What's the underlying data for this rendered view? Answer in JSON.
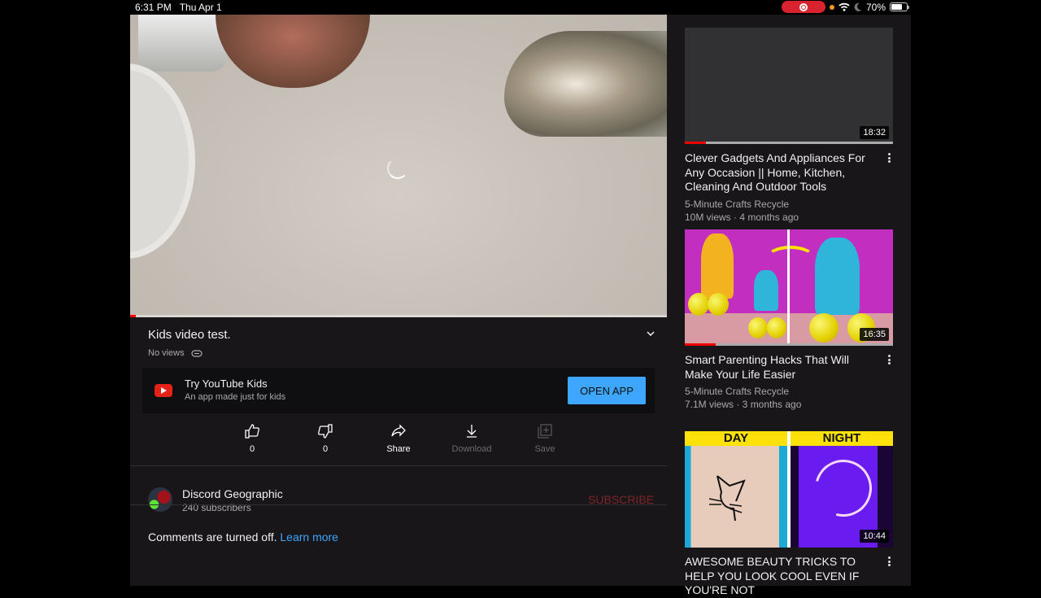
{
  "status_bar": {
    "time": "6:31 PM",
    "date": "Thu Apr 1",
    "battery": "70%",
    "battery_level": 0.7,
    "icons": [
      "screen-record-icon",
      "orange-dot-indicator",
      "wifi-icon",
      "moon-icon",
      "battery-icon"
    ]
  },
  "player": {
    "state": "loading",
    "progress": 0.01,
    "colors": {
      "progress": "#ff0000"
    }
  },
  "video": {
    "title": "Kids video test.",
    "views": "No views",
    "expand_icon": "chevron-down-icon"
  },
  "kids_promo": {
    "title": "Try YouTube Kids",
    "subtitle": "An app made just for kids",
    "button": "OPEN APP",
    "button_color": "#3ea6ff"
  },
  "actions": [
    {
      "label": "0",
      "icon": "thumbs-up-icon"
    },
    {
      "label": "0",
      "icon": "thumbs-down-icon"
    },
    {
      "label": "Share",
      "icon": "share-icon"
    },
    {
      "label": "Download",
      "icon": "download-icon",
      "disabled": true
    },
    {
      "label": "Save",
      "icon": "add-to-playlist-icon",
      "disabled": true
    }
  ],
  "channel": {
    "name": "Discord Geographic",
    "subscribers": "240 subscribers",
    "subscribe_label": "SUBSCRIBE"
  },
  "comments": {
    "text": "Comments are turned off.",
    "link": "Learn more"
  },
  "related": [
    {
      "title": "Clever Gadgets And Appliances For Any Occasion || Home, Kitchen, Cleaning And Outdoor Tools",
      "channel": "5-Minute Crafts Recycle",
      "meta": "10M views · 4 months ago",
      "duration": "18:32",
      "watched": 0.1
    },
    {
      "title": "Smart Parenting Hacks That Will Make Your Life Easier",
      "channel": "5-Minute Crafts Recycle",
      "meta": "7.1M views · 3 months ago",
      "duration": "16:35",
      "watched": 0.15
    },
    {
      "title": "AWESOME BEAUTY TRICKS TO HELP YOU LOOK COOL EVEN IF YOU'RE NOT",
      "duration": "10:44",
      "thumb_labels": [
        "DAY",
        "NIGHT"
      ]
    }
  ]
}
